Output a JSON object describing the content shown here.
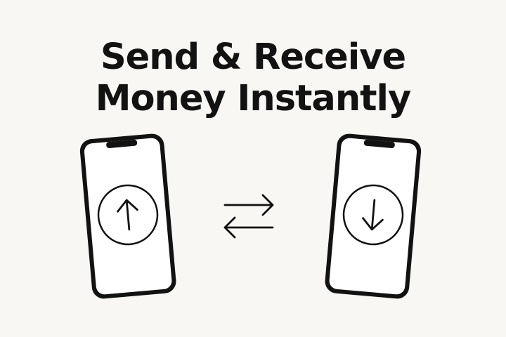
{
  "headline": {
    "line1": "Send & Receive",
    "line2": "Money Instantly"
  },
  "icons": {
    "left_phone": "smartphone-icon",
    "left_action": "arrow-up-circle-icon",
    "exchange": "swap-horizontal-arrows-icon",
    "right_phone": "smartphone-icon",
    "right_action": "arrow-down-circle-icon"
  },
  "colors": {
    "background": "#f9f7f4",
    "ink": "#121212",
    "screen": "#ffffff"
  }
}
